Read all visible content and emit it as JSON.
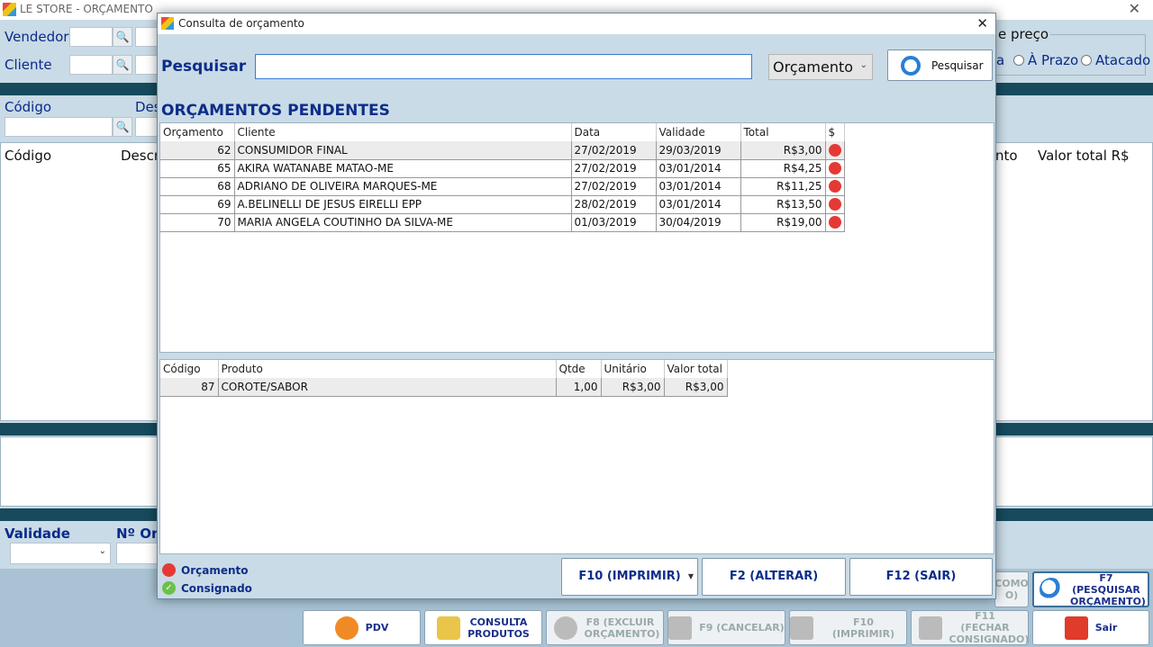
{
  "app": {
    "title": "LE STORE - ORÇAMENTO",
    "close": "✕"
  },
  "main": {
    "vendedor_label": "Vendedor",
    "cliente_label": "Cliente",
    "codigo_label": "Código",
    "descricao_label_partial": "Des",
    "grid_headers": {
      "codigo": "Código",
      "descricao_partial": "Descri",
      "partial": "nto",
      "valor_total": "Valor total R$"
    },
    "preco_group": "e preço",
    "preco_options": [
      "a",
      "À Prazo",
      "Atacado"
    ],
    "validade_label": "Validade",
    "numero_label_partial": "Nº Or",
    "search_glyph": "🔍",
    "buttons": {
      "como_partial": "COMO\nO)",
      "f7": "F7 (PESQUISAR ORÇAMENTO)",
      "pdv": "PDV",
      "consulta": "CONSULTA PRODUTOS",
      "f8": "F8 (EXCLUIR ORÇAMENTO)",
      "f9": "F9 (CANCELAR)",
      "f10": "F10 (IMPRIMIR)",
      "f11": "F11 (FECHAR CONSIGNADO)",
      "sair": "Sair"
    }
  },
  "dialog": {
    "title": "Consulta de orçamento",
    "close": "✕",
    "search_label": "Pesquisar",
    "search_value": "",
    "type_select": "Orçamento",
    "search_button": "Pesquisar",
    "section_title": "ORÇAMENTOS PENDENTES",
    "orders": {
      "headers": [
        "Orçamento",
        "Cliente",
        "Data",
        "Validade",
        "Total",
        "$"
      ],
      "rows": [
        [
          "62",
          "CONSUMIDOR FINAL",
          "27/02/2019",
          "29/03/2019",
          "R$3,00"
        ],
        [
          "65",
          "AKIRA WATANABE MATAO-ME",
          "27/02/2019",
          "03/01/2014",
          "R$4,25"
        ],
        [
          "68",
          "ADRIANO DE OLIVEIRA MARQUES-ME",
          "27/02/2019",
          "03/01/2014",
          "R$11,25"
        ],
        [
          "69",
          "A.BELINELLI DE JESUS EIRELLI EPP",
          "28/02/2019",
          "03/01/2014",
          "R$13,50"
        ],
        [
          "70",
          "MARIA ANGELA COUTINHO DA SILVA-ME",
          "01/03/2019",
          "30/04/2019",
          "R$19,00"
        ]
      ]
    },
    "items": {
      "headers": [
        "Código",
        "Produto",
        "Qtde",
        "Unitário",
        "Valor total"
      ],
      "rows": [
        [
          "87",
          "COROTE/SABOR",
          "1,00",
          "R$3,00",
          "R$3,00"
        ]
      ]
    },
    "legend": {
      "orcamento": "Orçamento",
      "consignado": "Consignado"
    },
    "buttons": {
      "imprimir": "F10 (IMPRIMIR)",
      "alterar": "F2 (ALTERAR)",
      "sair": "F12 (SAIR)"
    },
    "colors": {
      "status_red": "#e53935",
      "consignado_green": "#6cc04a",
      "title_blue": "#0d2d8a"
    }
  }
}
